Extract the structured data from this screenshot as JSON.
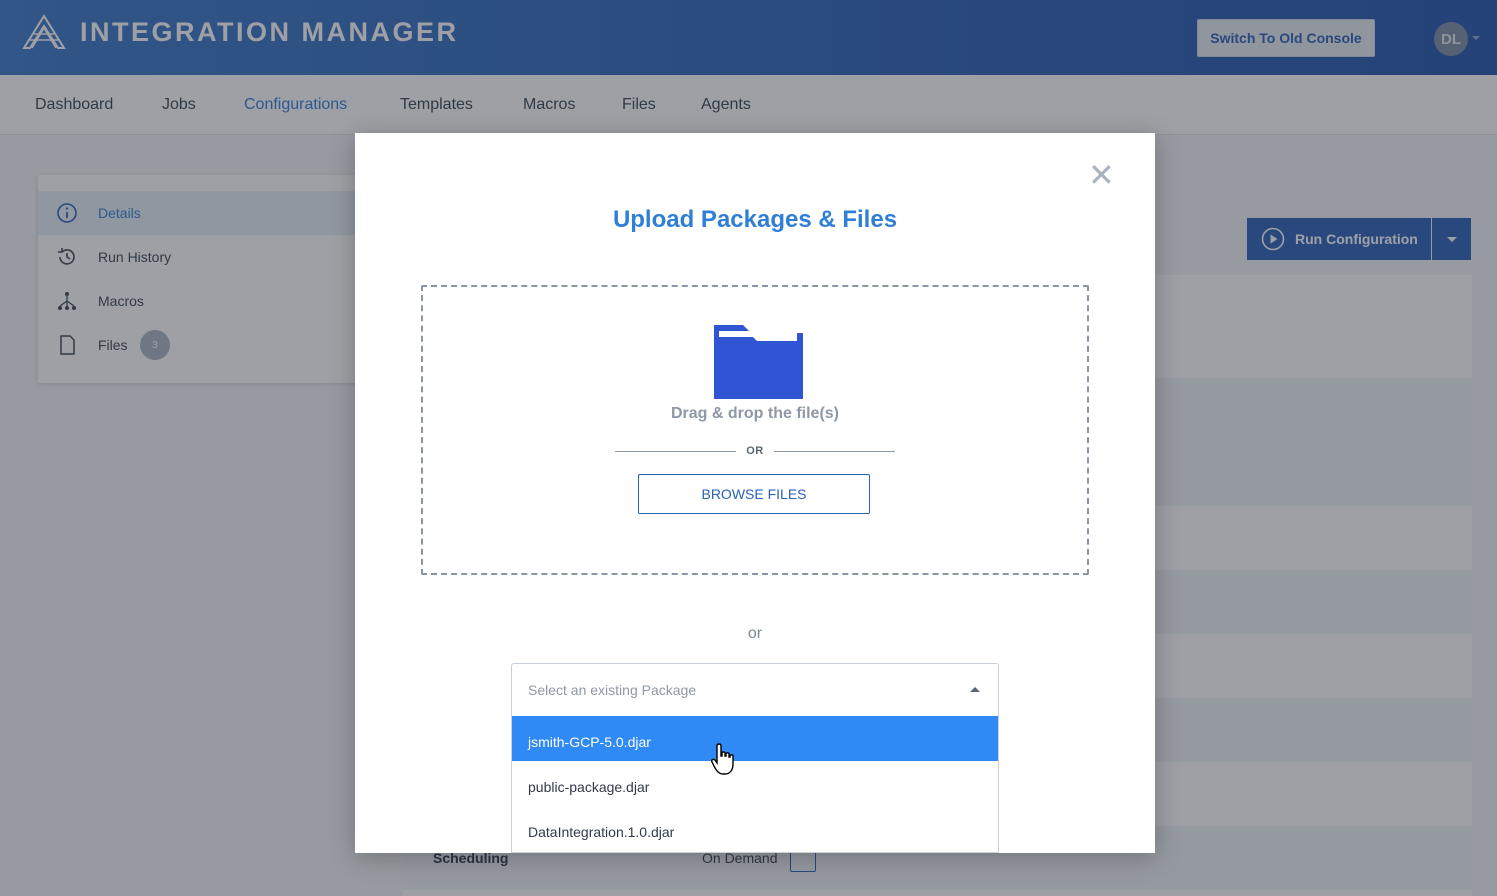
{
  "header": {
    "app_title": "INTEGRATION MANAGER",
    "old_console_label": "Switch To Old Console",
    "avatar_initials": "DL"
  },
  "nav": {
    "items": [
      "Dashboard",
      "Jobs",
      "Configurations",
      "Templates",
      "Macros",
      "Files",
      "Agents"
    ],
    "active": "Configurations"
  },
  "sidebar": {
    "items": [
      {
        "label": "Details",
        "icon": "info-icon",
        "active": true
      },
      {
        "label": "Run History",
        "icon": "history-icon"
      },
      {
        "label": "Macros",
        "icon": "macros-icon"
      },
      {
        "label": "Files",
        "icon": "file-icon",
        "badge": "3"
      }
    ]
  },
  "toolbar": {
    "run_label": "Run Configuration"
  },
  "details": {
    "scheduling_label": "Scheduling",
    "scheduling_value": "On Demand"
  },
  "modal": {
    "title": "Upload Packages & Files",
    "drag_text": "Drag & drop the file(s)",
    "or_upper": "OR",
    "browse_label": "BROWSE FILES",
    "or_lower": "or",
    "select_placeholder": "Select an existing Package",
    "options": [
      "jsmith-GCP-5.0.djar",
      "public-package.djar",
      "DataIntegration.1.0.djar"
    ],
    "highlighted_option": "jsmith-GCP-5.0.djar"
  },
  "colors": {
    "brand": "#2a62b8",
    "accent": "#2f7fd8",
    "highlight": "#2f8af5"
  }
}
